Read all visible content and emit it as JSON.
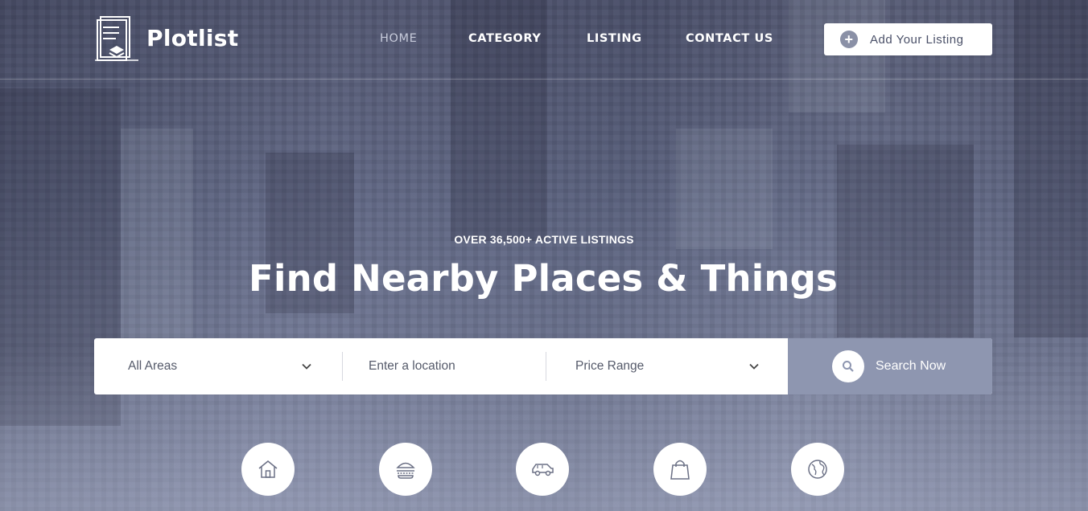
{
  "brand": {
    "name": "Plotlist"
  },
  "nav": {
    "items": [
      {
        "label": "HOME",
        "active": true
      },
      {
        "label": "CATEGORY",
        "active": false
      },
      {
        "label": "LISTING",
        "active": false
      },
      {
        "label": "CONTACT US",
        "active": false
      }
    ],
    "cta_label": "Add Your Listing"
  },
  "hero": {
    "eyebrow": "OVER 36,500+ ACTIVE LISTINGS",
    "headline": "Find Nearby Places & Things"
  },
  "search": {
    "area_value": "All Areas",
    "location_placeholder": "Enter a location",
    "price_value": "Price Range",
    "button_label": "Search Now"
  },
  "categories": [
    {
      "icon": "house-icon",
      "label": ""
    },
    {
      "icon": "burger-icon",
      "label": ""
    },
    {
      "icon": "car-icon",
      "label": ""
    },
    {
      "icon": "shopping-bag-icon",
      "label": ""
    },
    {
      "icon": "globe-icon",
      "label": ""
    }
  ],
  "colors": {
    "accent": "#8e96b0",
    "text_dark": "#555a6a",
    "white": "#ffffff"
  }
}
